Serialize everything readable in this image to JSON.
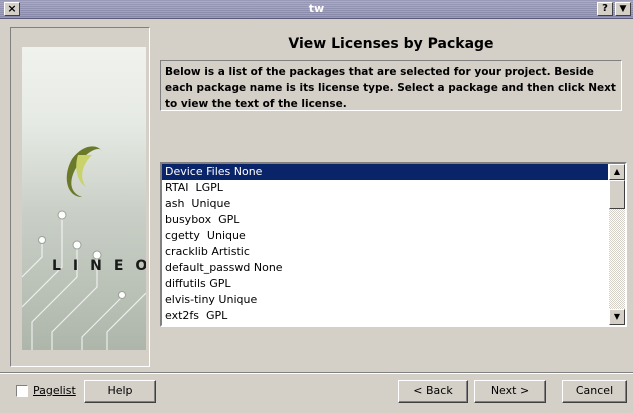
{
  "window": {
    "title": "tw",
    "close_glyph": "×",
    "help_glyph": "?",
    "menu_glyph": "▼"
  },
  "branding": {
    "logo_text": "LINEO"
  },
  "page": {
    "title": "View Licenses by Package",
    "description": "Below is a list of the packages that are selected for your project. Beside each package name is its license type. Select a package and then click Next to view the text of the license."
  },
  "packages": [
    "Device Files None",
    "RTAI  LGPL",
    "ash  Unique",
    "busybox  GPL",
    "cgetty  Unique",
    "cracklib Artistic",
    "default_passwd None",
    "diffutils GPL",
    "elvis-tiny Unique",
    "ext2fs  GPL"
  ],
  "selected_index": 0,
  "scrollbar": {
    "up_glyph": "▲",
    "down_glyph": "▼"
  },
  "footer": {
    "pagelist_label": "Pagelist",
    "help_label": "Help",
    "back_label": "< Back",
    "next_label": "Next >",
    "cancel_label": "Cancel"
  },
  "colors": {
    "selection": "#0a246a",
    "background": "#d4d0c8",
    "titlebar": "#8a8aaa"
  }
}
